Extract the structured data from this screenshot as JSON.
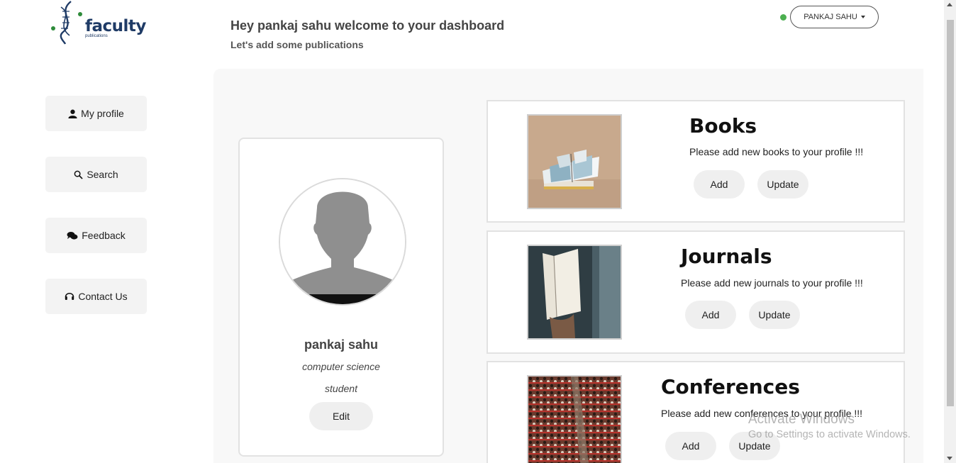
{
  "logo": {
    "brand": "faculty",
    "sub": "publications",
    "icon": "dna-helix-icon"
  },
  "header": {
    "welcome": "Hey pankaj sahu welcome to your dashboard",
    "subtitle": "Let's add some publications",
    "user_button": "PANKAJ SAHU",
    "online_color": "#4caf50"
  },
  "sidebar": {
    "items": [
      {
        "label": "My profile",
        "icon": "user-icon"
      },
      {
        "label": "Search",
        "icon": "search-icon"
      },
      {
        "label": "Feedback",
        "icon": "chat-icon"
      },
      {
        "label": "Contact Us",
        "icon": "headset-icon"
      }
    ]
  },
  "profile": {
    "name": "pankaj sahu",
    "department": "computer science",
    "role": "student",
    "edit_label": "Edit"
  },
  "cards": [
    {
      "title": "Books",
      "description": "Please add new books to your profile !!!",
      "add_label": "Add",
      "update_label": "Update"
    },
    {
      "title": "Journals",
      "description": "Please add new journals to your profile !!!",
      "add_label": "Add",
      "update_label": "Update"
    },
    {
      "title": "Conferences",
      "description": "Please add new conferences to your profile !!!",
      "add_label": "Add",
      "update_label": "Update"
    }
  ],
  "watermark": {
    "line1": "Activate Windows",
    "line2": "Go to Settings to activate Windows."
  }
}
